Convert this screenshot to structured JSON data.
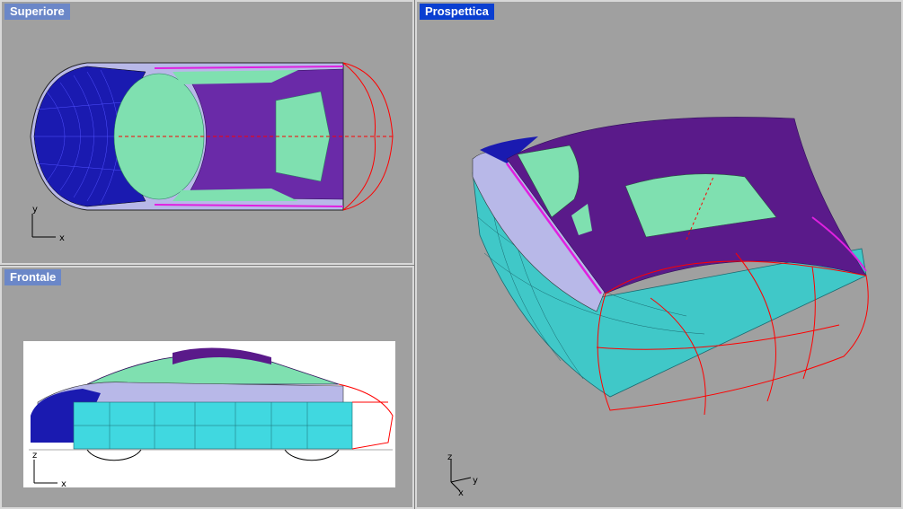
{
  "viewports": {
    "top": {
      "title": "Superiore",
      "axes": {
        "x": "x",
        "y": "y"
      }
    },
    "front": {
      "title": "Frontale",
      "axes": {
        "x": "x",
        "z": "z"
      }
    },
    "perspective": {
      "title": "Prospettica",
      "axes": {
        "x": "x",
        "y": "y",
        "z": "z"
      }
    }
  },
  "colors": {
    "viewport_bg": "#a0a0a0",
    "active_title": "#0a3fd1",
    "inactive_title": "#6b87c8",
    "roof_purple": "#5a1a8a",
    "glass_green": "#7fe0b0",
    "body_cyan": "#40c8c8",
    "side_lavender": "#b8b8e8",
    "dark_blue": "#1a1ab0",
    "curve_red": "#ff0000",
    "magenta": "#e020e0"
  }
}
